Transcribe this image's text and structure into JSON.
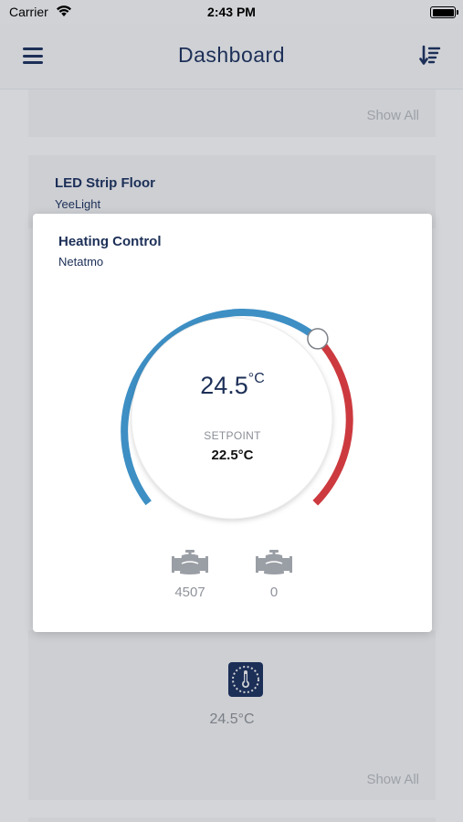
{
  "status_bar": {
    "carrier": "Carrier",
    "time": "2:43 PM"
  },
  "app_bar": {
    "title": "Dashboard"
  },
  "cards": {
    "top": {
      "show_all": "Show All"
    },
    "led": {
      "title": "LED Strip Floor",
      "subtitle": "YeeLight"
    },
    "sensor": {
      "temperature": "24.5°C",
      "show_all": "Show All"
    }
  },
  "modal": {
    "title": "Heating Control",
    "subtitle": "Netatmo",
    "temperature": "24.5",
    "temperature_unit": "°C",
    "setpoint_label": "SETPOINT",
    "setpoint_value": "22.5°C",
    "valves": [
      {
        "icon": "valve-icon",
        "value": "4507"
      },
      {
        "icon": "valve-icon",
        "value": "0"
      }
    ]
  },
  "colors": {
    "brand": "#1c2f57",
    "cool_arc": "#3d8fc4",
    "warm_arc": "#cc3a3f"
  }
}
